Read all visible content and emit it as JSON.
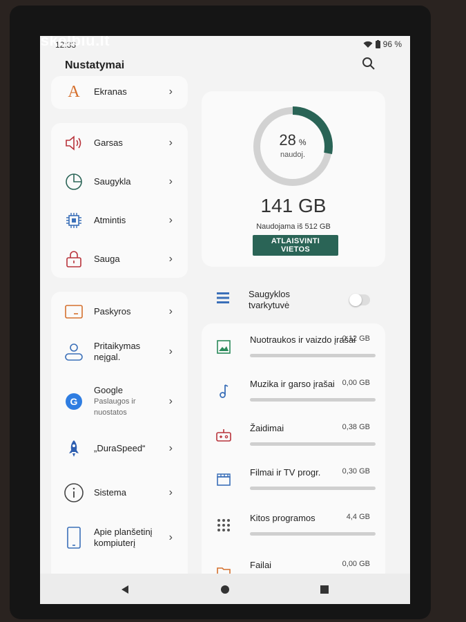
{
  "status": {
    "time": "12:33",
    "battery": "96 %"
  },
  "watermark": "skelbiu.lt",
  "header": {
    "title": "Nustatymai"
  },
  "sidebar": {
    "items": [
      {
        "label": "Ekranas",
        "icon": "display-icon"
      },
      {
        "label": "Garsas",
        "icon": "speaker-icon"
      },
      {
        "label": "Saugykla",
        "icon": "storage-pie-icon"
      },
      {
        "label": "Atmintis",
        "icon": "memory-chip-icon"
      },
      {
        "label": "Sauga",
        "icon": "lock-icon"
      },
      {
        "label": "Paskyros",
        "icon": "accounts-icon"
      },
      {
        "label": "Pritaikymas neįgal.",
        "icon": "accessibility-icon"
      },
      {
        "label": "Google",
        "sublabel": "Paslaugos ir nuostatos",
        "icon": "google-icon"
      },
      {
        "label": "„DuraSpeed“",
        "icon": "rocket-icon"
      },
      {
        "label": "Sistema",
        "icon": "info-icon"
      },
      {
        "label": "Apie planšetinį kompiuterį",
        "icon": "tablet-icon"
      }
    ]
  },
  "storage": {
    "percent": "28",
    "percent_unit": "%",
    "used_label": "naudoj.",
    "used_fraction": 0.28,
    "total": "141 GB",
    "total_sub": "Naudojama iš 512 GB",
    "free_button": "ATLAISVINTI VIETOS",
    "manager_label": "Saugyklos tvarkytuvė",
    "manager_enabled": false,
    "accent_color": "#2a6456",
    "categories": [
      {
        "name": "Nuotraukos ir vaizdo įrašai",
        "size": "0,12 GB",
        "icon": "photos-icon",
        "fill": 0.0
      },
      {
        "name": "Muzika ir garso įrašai",
        "size": "0,00 GB",
        "icon": "music-note-icon",
        "fill": 0.0
      },
      {
        "name": "Žaidimai",
        "size": "0,38 GB",
        "icon": "gamepad-icon",
        "fill": 0.0
      },
      {
        "name": "Filmai ir TV progr.",
        "size": "0,30 GB",
        "icon": "movie-icon",
        "fill": 0.0
      },
      {
        "name": "Kitos programos",
        "size": "4,4 GB",
        "icon": "apps-grid-icon",
        "fill": 0.0
      },
      {
        "name": "Failai",
        "size": "0,00 GB",
        "icon": "folder-icon",
        "fill": 0.0
      }
    ]
  }
}
